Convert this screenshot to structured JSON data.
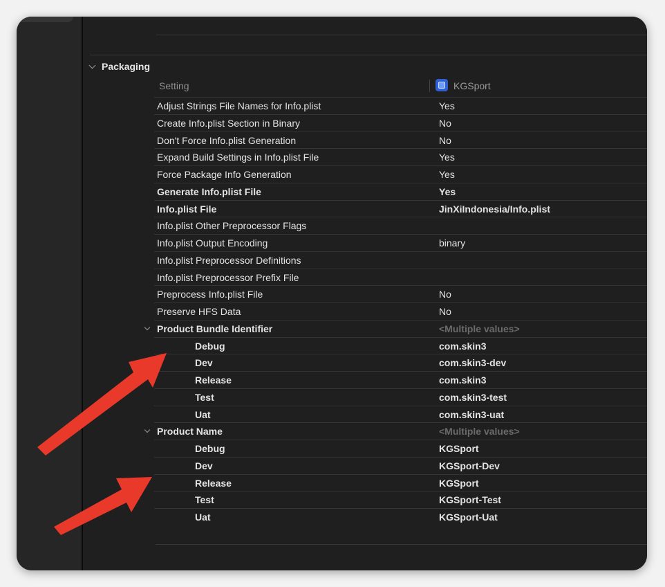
{
  "section": {
    "title": "Packaging"
  },
  "columns": {
    "setting": "Setting",
    "target": "KGSport"
  },
  "rows": [
    {
      "label": "Adjust Strings File Names for Info.plist",
      "value": "Yes",
      "kind": "normal"
    },
    {
      "label": "Create Info.plist Section in Binary",
      "value": "No",
      "kind": "normal"
    },
    {
      "label": "Don't Force Info.plist Generation",
      "value": "No",
      "kind": "normal"
    },
    {
      "label": "Expand Build Settings in Info.plist File",
      "value": "Yes",
      "kind": "normal"
    },
    {
      "label": "Force Package Info Generation",
      "value": "Yes",
      "kind": "normal"
    },
    {
      "label": "Generate Info.plist File",
      "value": "Yes",
      "kind": "bold"
    },
    {
      "label": "Info.plist File",
      "value": "JinXiIndonesia/Info.plist",
      "kind": "bold"
    },
    {
      "label": "Info.plist Other Preprocessor Flags",
      "value": "",
      "kind": "normal"
    },
    {
      "label": "Info.plist Output Encoding",
      "value": "binary",
      "kind": "normal"
    },
    {
      "label": "Info.plist Preprocessor Definitions",
      "value": "",
      "kind": "normal"
    },
    {
      "label": "Info.plist Preprocessor Prefix File",
      "value": "",
      "kind": "normal"
    },
    {
      "label": "Preprocess Info.plist File",
      "value": "No",
      "kind": "normal"
    },
    {
      "label": "Preserve HFS Data",
      "value": "No",
      "kind": "normal"
    },
    {
      "label": "Product Bundle Identifier",
      "value": "<Multiple values>",
      "kind": "group"
    },
    {
      "label": "Debug",
      "value": "com.skin3",
      "kind": "sub"
    },
    {
      "label": "Dev",
      "value": "com.skin3-dev",
      "kind": "sub"
    },
    {
      "label": "Release",
      "value": "com.skin3",
      "kind": "sub"
    },
    {
      "label": "Test",
      "value": "com.skin3-test",
      "kind": "sub"
    },
    {
      "label": "Uat",
      "value": "com.skin3-uat",
      "kind": "sub"
    },
    {
      "label": "Product Name",
      "value": "<Multiple values>",
      "kind": "group"
    },
    {
      "label": "Debug",
      "value": "KGSport",
      "kind": "sub"
    },
    {
      "label": "Dev",
      "value": "KGSport-Dev",
      "kind": "sub"
    },
    {
      "label": "Release",
      "value": "KGSport",
      "kind": "sub"
    },
    {
      "label": "Test",
      "value": "KGSport-Test",
      "kind": "sub"
    },
    {
      "label": "Uat",
      "value": "KGSport-Uat",
      "kind": "sub"
    }
  ],
  "colors": {
    "annotation_arrow": "#e8392b",
    "background": "#1f1f1f",
    "text": "#e3e3e3"
  }
}
